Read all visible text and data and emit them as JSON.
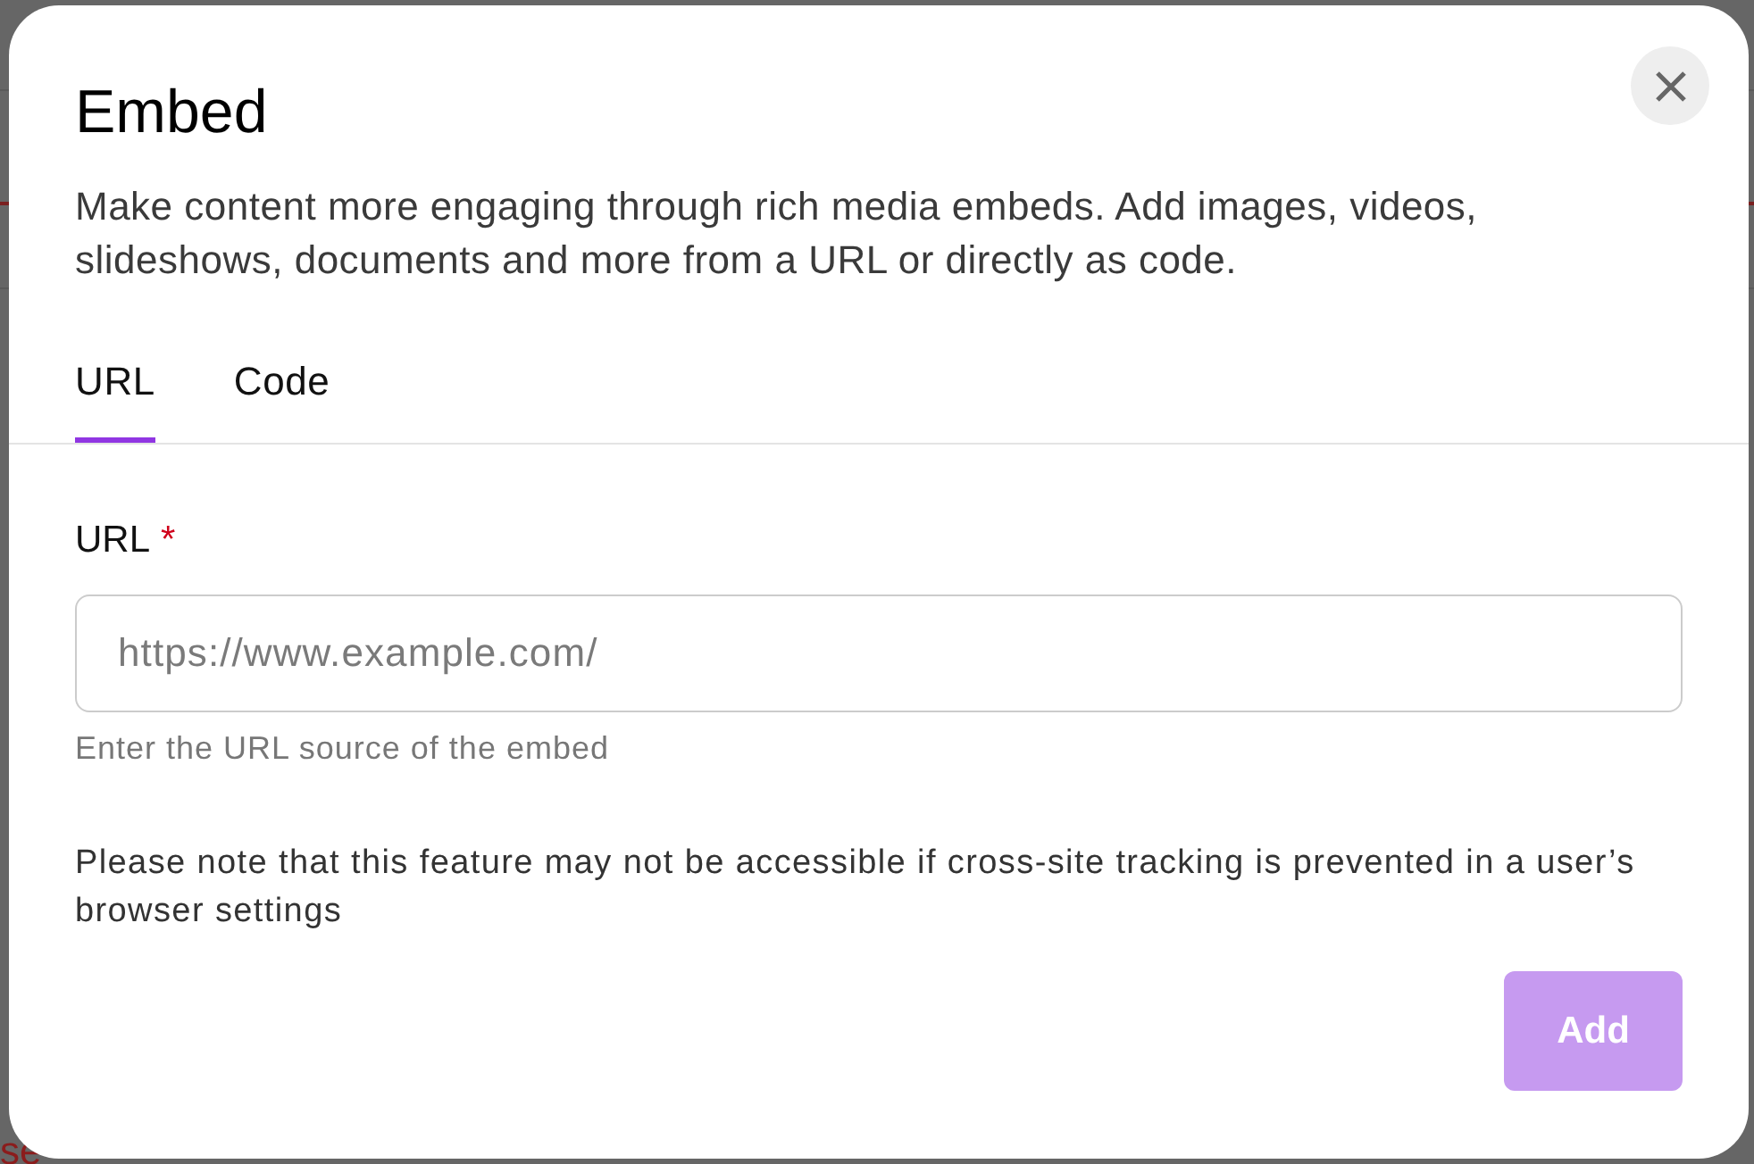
{
  "backdrop": {
    "fragments": [
      {
        "text": "se",
        "color": "#8b1c1c"
      }
    ]
  },
  "dialog": {
    "title": "Embed",
    "description": "Make content more engaging through rich media embeds. Add images, videos, slideshows, documents and more from a URL or directly as code."
  },
  "tabs": [
    {
      "label": "URL",
      "selected": true
    },
    {
      "label": "Code",
      "selected": false
    }
  ],
  "url_field": {
    "label": "URL",
    "required_mark": "*",
    "placeholder": "https://www.example.com/",
    "helper": "Enter the URL source of the embed"
  },
  "note": "Please note that this feature may not be accessible if cross-site tracking is prevented in a user’s browser settings",
  "buttons": [
    {
      "label": "Add",
      "disabled": true
    }
  ]
}
